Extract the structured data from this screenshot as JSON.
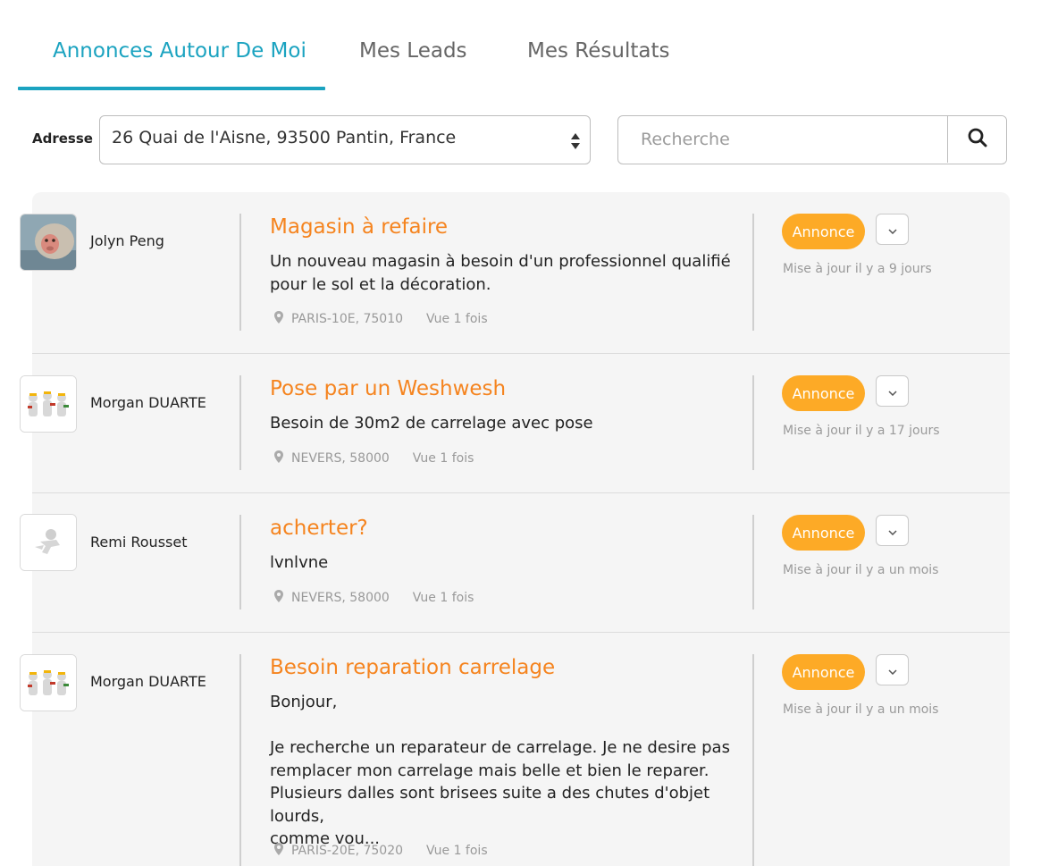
{
  "tabs": [
    {
      "label": "Annonces Autour De Moi",
      "active": true
    },
    {
      "label": "Mes Leads",
      "active": false
    },
    {
      "label": "Mes Résultats",
      "active": false
    }
  ],
  "address": {
    "label": "Adresse",
    "value": "26 Quai de l'Aisne, 93500 Pantin, France"
  },
  "search": {
    "placeholder": "Recherche",
    "icon": "search-icon"
  },
  "colors": {
    "accent": "#1ba3c0",
    "title": "#f5841f",
    "badge": "#fdaa26"
  },
  "leads": [
    {
      "author": "Jolyn Peng",
      "avatar": "monkey-photo",
      "title": "Magasin à refaire",
      "description": "Un nouveau magasin à besoin d'un professionnel qualifié\npour le sol et la décoration.",
      "location": "PARIS-10E, 75010",
      "views": "Vue 1 fois",
      "badge": "Annonce",
      "updated": "Mise à jour il y a 9 jours"
    },
    {
      "author": "Morgan DUARTE",
      "avatar": "workers-figures",
      "title": "Pose par un Weshwesh",
      "description": "Besoin de 30m2 de carrelage avec pose",
      "location": "NEVERS, 58000",
      "views": "Vue 1 fois",
      "badge": "Annonce",
      "updated": "Mise à jour il y a 17 jours"
    },
    {
      "author": "Remi Rousset",
      "avatar": "placeholder-figure",
      "title": "acherter?",
      "description": "lvnlvne",
      "location": "NEVERS, 58000",
      "views": "Vue 1 fois",
      "badge": "Annonce",
      "updated": "Mise à jour il y a un mois"
    },
    {
      "author": "Morgan DUARTE",
      "avatar": "workers-figures",
      "title": "Besoin reparation carrelage",
      "description": "Bonjour,\n\nJe recherche un reparateur de carrelage. Je ne desire pas\nremplacer mon carrelage mais belle et bien le reparer.\nPlusieurs dalles sont brisees suite a des chutes d'objet lourds,\ncomme vou...",
      "location": "PARIS-20E, 75020",
      "views": "Vue 1 fois",
      "badge": "Annonce",
      "updated": "Mise à jour il y a un mois"
    }
  ]
}
